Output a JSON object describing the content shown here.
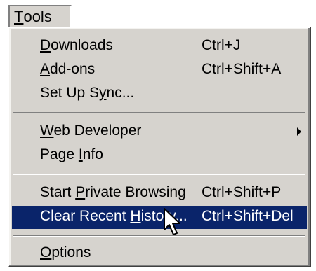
{
  "menubar": {
    "tools_label": "Tools",
    "tools_mnemonic": "T",
    "tools_rest": "ools"
  },
  "menu": {
    "items": [
      {
        "pre": "",
        "mn": "D",
        "post": "ownloads",
        "shortcut": "Ctrl+J"
      },
      {
        "pre": "",
        "mn": "A",
        "post": "dd-ons",
        "shortcut": "Ctrl+Shift+A"
      },
      {
        "pre": "Set Up S",
        "mn": "y",
        "post": "nc...",
        "shortcut": ""
      },
      {
        "pre": "",
        "mn": "W",
        "post": "eb Developer",
        "shortcut": "",
        "submenu_icon": "chevron-right-icon"
      },
      {
        "pre": "Page ",
        "mn": "I",
        "post": "nfo",
        "shortcut": ""
      },
      {
        "pre": "Start ",
        "mn": "P",
        "post": "rivate Browsing",
        "shortcut": "Ctrl+Shift+P"
      },
      {
        "pre": "Clear Recent ",
        "mn": "H",
        "post": "istory...",
        "shortcut": "Ctrl+Shift+Del",
        "selected": true
      },
      {
        "pre": "",
        "mn": "O",
        "post": "ptions",
        "shortcut": ""
      }
    ]
  },
  "colors": {
    "menu_bg": "#d6d3ce",
    "highlight": "#0a246a",
    "highlight_text": "#ffffff"
  },
  "cursor_icon": "arrow-pointer-icon"
}
